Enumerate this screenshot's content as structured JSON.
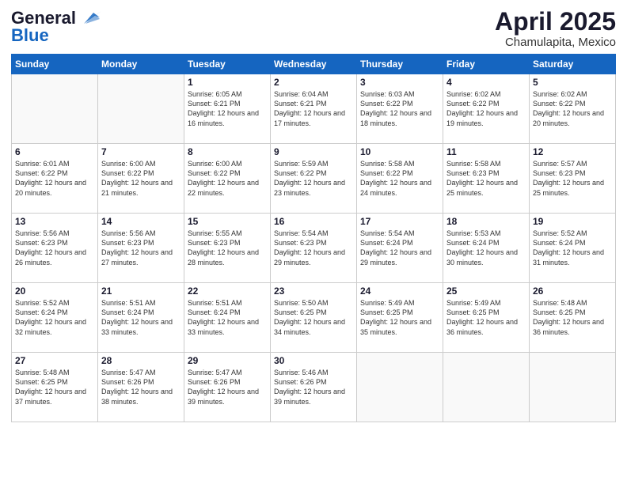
{
  "logo": {
    "line1": "General",
    "line2": "Blue"
  },
  "title": "April 2025",
  "subtitle": "Chamulapita, Mexico",
  "weekdays": [
    "Sunday",
    "Monday",
    "Tuesday",
    "Wednesday",
    "Thursday",
    "Friday",
    "Saturday"
  ],
  "weeks": [
    [
      {
        "day": "",
        "info": ""
      },
      {
        "day": "",
        "info": ""
      },
      {
        "day": "1",
        "info": "Sunrise: 6:05 AM\nSunset: 6:21 PM\nDaylight: 12 hours and 16 minutes."
      },
      {
        "day": "2",
        "info": "Sunrise: 6:04 AM\nSunset: 6:21 PM\nDaylight: 12 hours and 17 minutes."
      },
      {
        "day": "3",
        "info": "Sunrise: 6:03 AM\nSunset: 6:22 PM\nDaylight: 12 hours and 18 minutes."
      },
      {
        "day": "4",
        "info": "Sunrise: 6:02 AM\nSunset: 6:22 PM\nDaylight: 12 hours and 19 minutes."
      },
      {
        "day": "5",
        "info": "Sunrise: 6:02 AM\nSunset: 6:22 PM\nDaylight: 12 hours and 20 minutes."
      }
    ],
    [
      {
        "day": "6",
        "info": "Sunrise: 6:01 AM\nSunset: 6:22 PM\nDaylight: 12 hours and 20 minutes."
      },
      {
        "day": "7",
        "info": "Sunrise: 6:00 AM\nSunset: 6:22 PM\nDaylight: 12 hours and 21 minutes."
      },
      {
        "day": "8",
        "info": "Sunrise: 6:00 AM\nSunset: 6:22 PM\nDaylight: 12 hours and 22 minutes."
      },
      {
        "day": "9",
        "info": "Sunrise: 5:59 AM\nSunset: 6:22 PM\nDaylight: 12 hours and 23 minutes."
      },
      {
        "day": "10",
        "info": "Sunrise: 5:58 AM\nSunset: 6:22 PM\nDaylight: 12 hours and 24 minutes."
      },
      {
        "day": "11",
        "info": "Sunrise: 5:58 AM\nSunset: 6:23 PM\nDaylight: 12 hours and 25 minutes."
      },
      {
        "day": "12",
        "info": "Sunrise: 5:57 AM\nSunset: 6:23 PM\nDaylight: 12 hours and 25 minutes."
      }
    ],
    [
      {
        "day": "13",
        "info": "Sunrise: 5:56 AM\nSunset: 6:23 PM\nDaylight: 12 hours and 26 minutes."
      },
      {
        "day": "14",
        "info": "Sunrise: 5:56 AM\nSunset: 6:23 PM\nDaylight: 12 hours and 27 minutes."
      },
      {
        "day": "15",
        "info": "Sunrise: 5:55 AM\nSunset: 6:23 PM\nDaylight: 12 hours and 28 minutes."
      },
      {
        "day": "16",
        "info": "Sunrise: 5:54 AM\nSunset: 6:23 PM\nDaylight: 12 hours and 29 minutes."
      },
      {
        "day": "17",
        "info": "Sunrise: 5:54 AM\nSunset: 6:24 PM\nDaylight: 12 hours and 29 minutes."
      },
      {
        "day": "18",
        "info": "Sunrise: 5:53 AM\nSunset: 6:24 PM\nDaylight: 12 hours and 30 minutes."
      },
      {
        "day": "19",
        "info": "Sunrise: 5:52 AM\nSunset: 6:24 PM\nDaylight: 12 hours and 31 minutes."
      }
    ],
    [
      {
        "day": "20",
        "info": "Sunrise: 5:52 AM\nSunset: 6:24 PM\nDaylight: 12 hours and 32 minutes."
      },
      {
        "day": "21",
        "info": "Sunrise: 5:51 AM\nSunset: 6:24 PM\nDaylight: 12 hours and 33 minutes."
      },
      {
        "day": "22",
        "info": "Sunrise: 5:51 AM\nSunset: 6:24 PM\nDaylight: 12 hours and 33 minutes."
      },
      {
        "day": "23",
        "info": "Sunrise: 5:50 AM\nSunset: 6:25 PM\nDaylight: 12 hours and 34 minutes."
      },
      {
        "day": "24",
        "info": "Sunrise: 5:49 AM\nSunset: 6:25 PM\nDaylight: 12 hours and 35 minutes."
      },
      {
        "day": "25",
        "info": "Sunrise: 5:49 AM\nSunset: 6:25 PM\nDaylight: 12 hours and 36 minutes."
      },
      {
        "day": "26",
        "info": "Sunrise: 5:48 AM\nSunset: 6:25 PM\nDaylight: 12 hours and 36 minutes."
      }
    ],
    [
      {
        "day": "27",
        "info": "Sunrise: 5:48 AM\nSunset: 6:25 PM\nDaylight: 12 hours and 37 minutes."
      },
      {
        "day": "28",
        "info": "Sunrise: 5:47 AM\nSunset: 6:26 PM\nDaylight: 12 hours and 38 minutes."
      },
      {
        "day": "29",
        "info": "Sunrise: 5:47 AM\nSunset: 6:26 PM\nDaylight: 12 hours and 39 minutes."
      },
      {
        "day": "30",
        "info": "Sunrise: 5:46 AM\nSunset: 6:26 PM\nDaylight: 12 hours and 39 minutes."
      },
      {
        "day": "",
        "info": ""
      },
      {
        "day": "",
        "info": ""
      },
      {
        "day": "",
        "info": ""
      }
    ]
  ]
}
